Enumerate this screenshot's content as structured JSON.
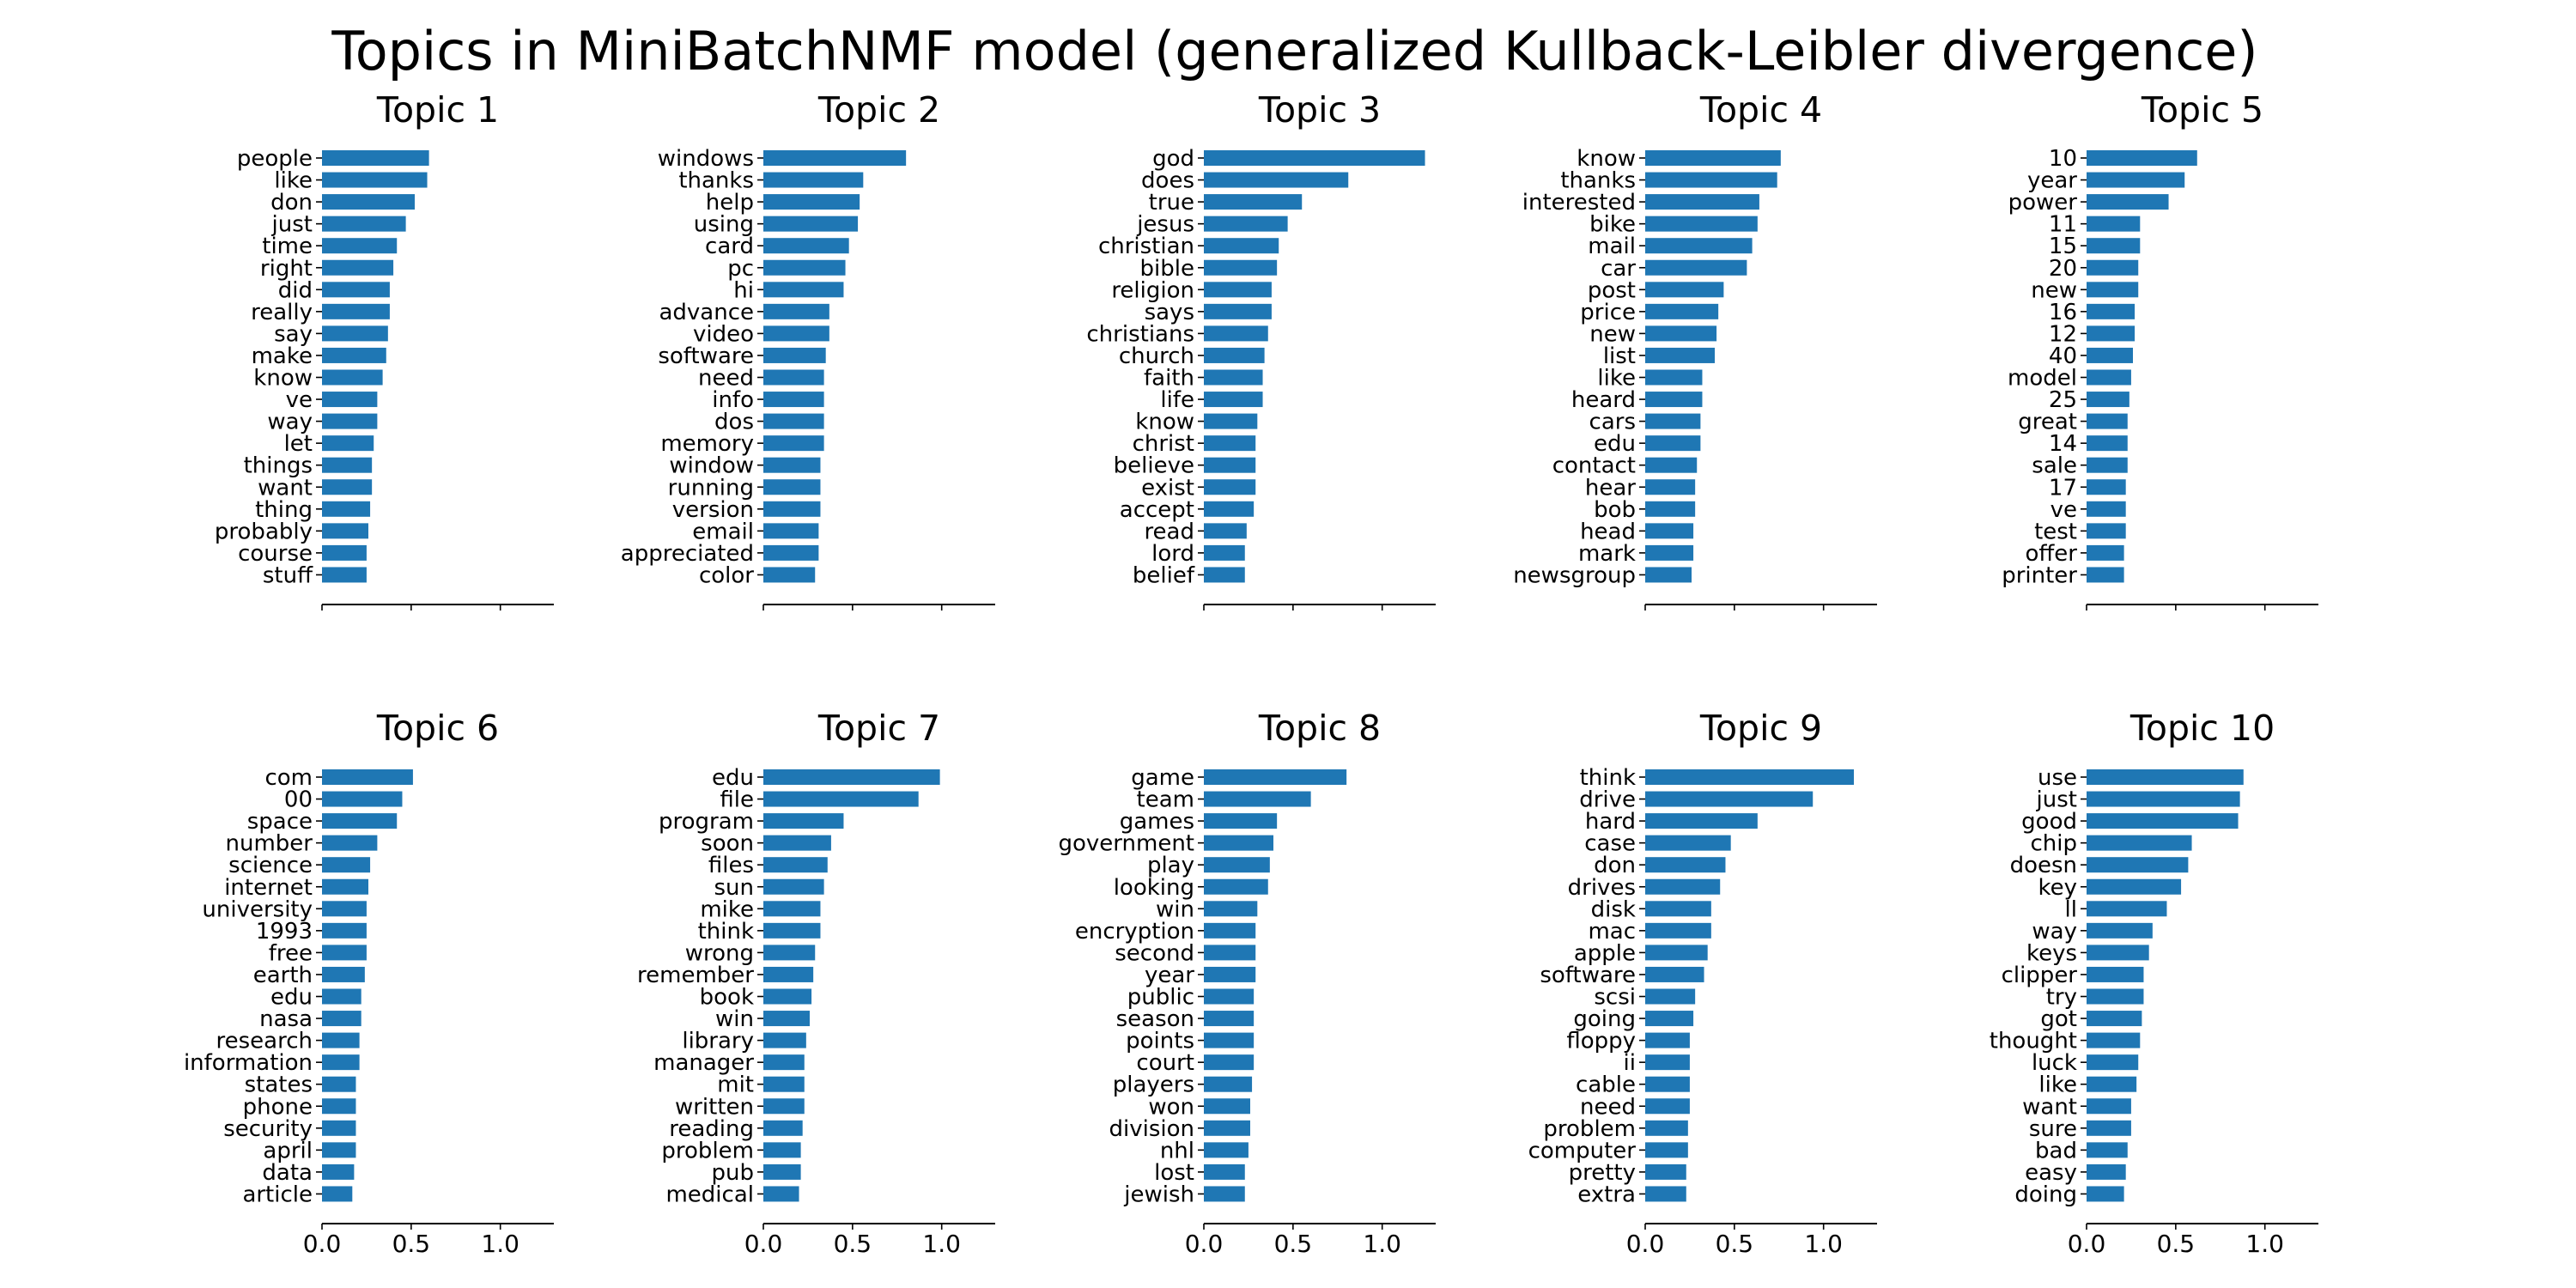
{
  "chart_data": {
    "type": "bar",
    "orientation": "horizontal",
    "title": "Topics in MiniBatchNMF model (generalized Kullback-Leibler divergence)",
    "bar_color": "#1f77b4",
    "grid": false,
    "xlim": [
      0,
      1.3
    ],
    "xticks": [
      0.0,
      0.5,
      1.0
    ],
    "xtick_labels": [
      "0.0",
      "0.5",
      "1.0"
    ],
    "layout": {
      "rows": 2,
      "cols": 5,
      "shared_x": true
    },
    "panels": [
      {
        "title": "Topic 1",
        "categories": [
          "people",
          "like",
          "don",
          "just",
          "time",
          "right",
          "did",
          "really",
          "say",
          "make",
          "know",
          "ve",
          "way",
          "let",
          "things",
          "want",
          "thing",
          "probably",
          "course",
          "stuff"
        ],
        "values": [
          0.6,
          0.59,
          0.52,
          0.47,
          0.42,
          0.4,
          0.38,
          0.38,
          0.37,
          0.36,
          0.34,
          0.31,
          0.31,
          0.29,
          0.28,
          0.28,
          0.27,
          0.26,
          0.25,
          0.25
        ]
      },
      {
        "title": "Topic 2",
        "categories": [
          "windows",
          "thanks",
          "help",
          "using",
          "card",
          "pc",
          "hi",
          "advance",
          "video",
          "software",
          "need",
          "info",
          "dos",
          "memory",
          "window",
          "running",
          "version",
          "email",
          "appreciated",
          "color"
        ],
        "values": [
          0.8,
          0.56,
          0.54,
          0.53,
          0.48,
          0.46,
          0.45,
          0.37,
          0.37,
          0.35,
          0.34,
          0.34,
          0.34,
          0.34,
          0.32,
          0.32,
          0.32,
          0.31,
          0.31,
          0.29
        ]
      },
      {
        "title": "Topic 3",
        "categories": [
          "god",
          "does",
          "true",
          "jesus",
          "christian",
          "bible",
          "religion",
          "says",
          "christians",
          "church",
          "faith",
          "life",
          "know",
          "christ",
          "believe",
          "exist",
          "accept",
          "read",
          "lord",
          "belief"
        ],
        "values": [
          1.24,
          0.81,
          0.55,
          0.47,
          0.42,
          0.41,
          0.38,
          0.38,
          0.36,
          0.34,
          0.33,
          0.33,
          0.3,
          0.29,
          0.29,
          0.29,
          0.28,
          0.24,
          0.23,
          0.23
        ]
      },
      {
        "title": "Topic 4",
        "categories": [
          "know",
          "thanks",
          "interested",
          "bike",
          "mail",
          "car",
          "post",
          "price",
          "new",
          "list",
          "like",
          "heard",
          "cars",
          "edu",
          "contact",
          "hear",
          "bob",
          "head",
          "mark",
          "newsgroup"
        ],
        "values": [
          0.76,
          0.74,
          0.64,
          0.63,
          0.6,
          0.57,
          0.44,
          0.41,
          0.4,
          0.39,
          0.32,
          0.32,
          0.31,
          0.31,
          0.29,
          0.28,
          0.28,
          0.27,
          0.27,
          0.26
        ]
      },
      {
        "title": "Topic 5",
        "categories": [
          "10",
          "year",
          "power",
          "11",
          "15",
          "20",
          "new",
          "16",
          "12",
          "40",
          "model",
          "25",
          "great",
          "14",
          "sale",
          "17",
          "ve",
          "test",
          "offer",
          "printer"
        ],
        "values": [
          0.62,
          0.55,
          0.46,
          0.3,
          0.3,
          0.29,
          0.29,
          0.27,
          0.27,
          0.26,
          0.25,
          0.24,
          0.23,
          0.23,
          0.23,
          0.22,
          0.22,
          0.22,
          0.21,
          0.21
        ]
      },
      {
        "title": "Topic 6",
        "categories": [
          "com",
          "00",
          "space",
          "number",
          "science",
          "internet",
          "university",
          "1993",
          "free",
          "earth",
          "edu",
          "nasa",
          "research",
          "information",
          "states",
          "phone",
          "security",
          "april",
          "data",
          "article"
        ],
        "values": [
          0.51,
          0.45,
          0.42,
          0.31,
          0.27,
          0.26,
          0.25,
          0.25,
          0.25,
          0.24,
          0.22,
          0.22,
          0.21,
          0.21,
          0.19,
          0.19,
          0.19,
          0.19,
          0.18,
          0.17
        ]
      },
      {
        "title": "Topic 7",
        "categories": [
          "edu",
          "file",
          "program",
          "soon",
          "files",
          "sun",
          "mike",
          "think",
          "wrong",
          "remember",
          "book",
          "win",
          "library",
          "manager",
          "mit",
          "written",
          "reading",
          "problem",
          "pub",
          "medical"
        ],
        "values": [
          0.99,
          0.87,
          0.45,
          0.38,
          0.36,
          0.34,
          0.32,
          0.32,
          0.29,
          0.28,
          0.27,
          0.26,
          0.24,
          0.23,
          0.23,
          0.23,
          0.22,
          0.21,
          0.21,
          0.2
        ]
      },
      {
        "title": "Topic 8",
        "categories": [
          "game",
          "team",
          "games",
          "government",
          "play",
          "looking",
          "win",
          "encryption",
          "second",
          "year",
          "public",
          "season",
          "points",
          "court",
          "players",
          "won",
          "division",
          "nhl",
          "lost",
          "jewish"
        ],
        "values": [
          0.8,
          0.6,
          0.41,
          0.39,
          0.37,
          0.36,
          0.3,
          0.29,
          0.29,
          0.29,
          0.28,
          0.28,
          0.28,
          0.28,
          0.27,
          0.26,
          0.26,
          0.25,
          0.23,
          0.23
        ]
      },
      {
        "title": "Topic 9",
        "categories": [
          "think",
          "drive",
          "hard",
          "case",
          "don",
          "drives",
          "disk",
          "mac",
          "apple",
          "software",
          "scsi",
          "going",
          "floppy",
          "ii",
          "cable",
          "need",
          "problem",
          "computer",
          "pretty",
          "extra"
        ],
        "values": [
          1.17,
          0.94,
          0.63,
          0.48,
          0.45,
          0.42,
          0.37,
          0.37,
          0.35,
          0.33,
          0.28,
          0.27,
          0.25,
          0.25,
          0.25,
          0.25,
          0.24,
          0.24,
          0.23,
          0.23
        ]
      },
      {
        "title": "Topic 10",
        "categories": [
          "use",
          "just",
          "good",
          "chip",
          "doesn",
          "key",
          "ll",
          "way",
          "keys",
          "clipper",
          "try",
          "got",
          "thought",
          "luck",
          "like",
          "want",
          "sure",
          "bad",
          "easy",
          "doing"
        ],
        "values": [
          0.88,
          0.86,
          0.85,
          0.59,
          0.57,
          0.53,
          0.45,
          0.37,
          0.35,
          0.32,
          0.32,
          0.31,
          0.3,
          0.29,
          0.28,
          0.25,
          0.25,
          0.23,
          0.22,
          0.21
        ]
      }
    ]
  }
}
